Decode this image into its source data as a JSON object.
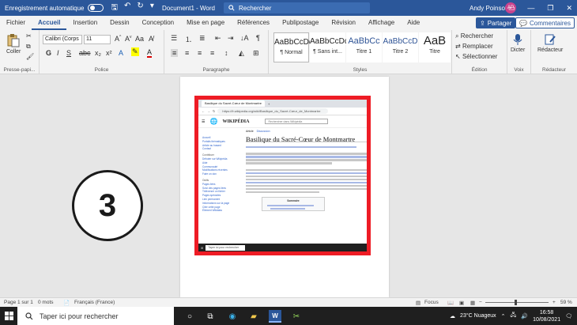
{
  "titlebar": {
    "autosave_label": "Enregistrement automatique",
    "doc_title": "Document1 - Word",
    "search_placeholder": "Rechercher",
    "user_name": "Andy Poinsot",
    "avatar_initials": "AP"
  },
  "tabs": [
    "Fichier",
    "Accueil",
    "Insertion",
    "Dessin",
    "Conception",
    "Mise en page",
    "Références",
    "Publipostage",
    "Révision",
    "Affichage",
    "Aide"
  ],
  "actions": {
    "share": "Partager",
    "comments": "Commentaires"
  },
  "ribbon": {
    "clipboard": {
      "paste": "Coller",
      "label": "Presse-papi..."
    },
    "font": {
      "font_name": "Calibri (Corps",
      "font_size": "11",
      "label": "Police"
    },
    "paragraph": {
      "label": "Paragraphe"
    },
    "styles": {
      "label": "Styles",
      "items": [
        {
          "sample": "AaBbCcDd",
          "name": "¶ Normal"
        },
        {
          "sample": "AaBbCcDd",
          "name": "¶ Sans int..."
        },
        {
          "sample": "AaBbCc",
          "name": "Titre 1"
        },
        {
          "sample": "AaBbCcD",
          "name": "Titre 2"
        },
        {
          "sample": "AaB",
          "name": "Titre"
        }
      ]
    },
    "editing": {
      "find": "Rechercher",
      "replace": "Remplacer",
      "select": "Sélectionner",
      "label": "Édition"
    },
    "voice": {
      "dictate": "Dicter",
      "label": "Voix"
    },
    "editor": {
      "editor": "Rédacteur",
      "label": "Rédacteur"
    }
  },
  "document": {
    "circle_number": "3"
  },
  "browser": {
    "tab_title": "Basilique du Sacré-Cœur de Montmartre",
    "url": "https://fr.wikipedia.org/wiki/Basilique_du_Sacré-Cœur_de_Montmartre",
    "wiki_logo": "WIKIPÉDIA",
    "wiki_search": "Rechercher dans Wikipédia",
    "article_title": "Basilique du Sacré-Cœur de Montmartre",
    "tabs": [
      "Article",
      "Discussion"
    ],
    "toc_title": "Sommaire",
    "sidebar": [
      "Accueil",
      "Portails thématiques",
      "Article au hasard",
      "Contact",
      "",
      "Contribuer",
      "Débuter sur Wikipédia",
      "Aide",
      "Communauté",
      "Modifications récentes",
      "Faire un don",
      "",
      "Outils",
      "Pages liées",
      "Suivi des pages liées",
      "Téléverser un fichier",
      "Pages spéciales",
      "Lien permanent",
      "Informations sur la page",
      "Citer cette page",
      "Élément Wikidata"
    ],
    "taskbar_search": "Taper ici pour rechercher"
  },
  "statusbar": {
    "page": "Page 1 sur 1",
    "words": "0 mots",
    "language": "Français (France)",
    "focus": "Focus",
    "zoom": "59 %"
  },
  "taskbar": {
    "search_placeholder": "Taper ici pour rechercher",
    "weather": "23°C  Nuageux",
    "time": "16:58",
    "date": "10/08/2021"
  }
}
